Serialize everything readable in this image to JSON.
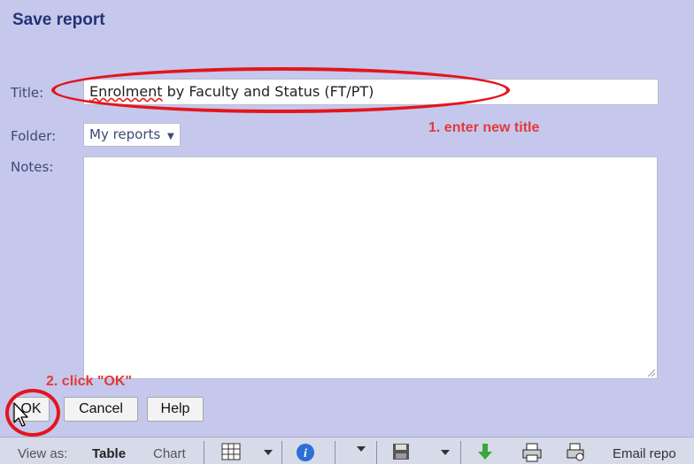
{
  "dialog": {
    "title": "Save report",
    "fields": {
      "title_label": "Title:",
      "title_value_first": "Enrolment",
      "title_value_rest": " by Faculty and Status (FT/PT)",
      "folder_label": "Folder:",
      "folder_value": "My reports",
      "folder_arrow": "▼",
      "notes_label": "Notes:"
    },
    "buttons": {
      "ok": "OK",
      "cancel": "Cancel",
      "help": "Help"
    }
  },
  "annotations": {
    "step1": "1. enter new title",
    "step2": "2. click \"OK\"",
    "color": "#e4151c"
  },
  "toolbar": {
    "view_as_label": "View as:",
    "table": "Table",
    "chart": "Chart",
    "email": "Email repo",
    "icons": [
      "table-grid-icon",
      "dropdown-arrow-icon",
      "info-icon",
      "dropdown-arrow-icon",
      "save-disk-icon",
      "dropdown-arrow-icon",
      "download-icon",
      "print-icon",
      "print-preview-icon"
    ]
  }
}
